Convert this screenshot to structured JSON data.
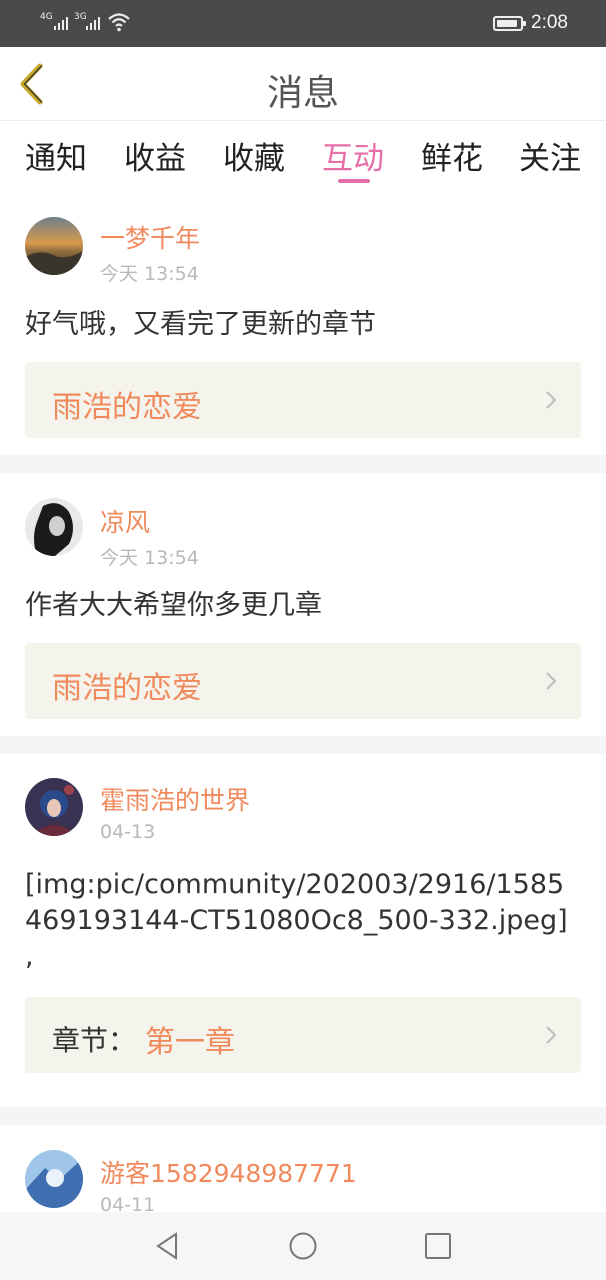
{
  "status_bar": {
    "signal1_label": "4G",
    "signal2_label": "3G",
    "wifi_icon": "wifi-icon",
    "battery_level": 0.9,
    "time": "2:08"
  },
  "header": {
    "title": "消息",
    "back_icon": "chevron-left-icon",
    "accent_color": "#c8a824"
  },
  "tabs": {
    "items": [
      {
        "label": "通知"
      },
      {
        "label": "收益"
      },
      {
        "label": "收藏"
      },
      {
        "label": "互动"
      },
      {
        "label": "鲜花"
      },
      {
        "label": "关注"
      }
    ],
    "active": "互动",
    "active_color": "#e76fa8"
  },
  "messages": [
    {
      "username": "一梦千年",
      "time": "今天 13:54",
      "content": "好气哦，又看完了更新的章节",
      "book_title": "雨浩的恋爱"
    },
    {
      "username": "凉风",
      "time": "今天 13:54",
      "content": "作者大大希望你多更几章",
      "book_title": "雨浩的恋爱"
    },
    {
      "username": "霍雨浩的世界",
      "time": "04-13",
      "content": "[img:pic/community/202003/2916/1585469193144-CT51080Oc8_500-332.jpeg] ,",
      "chapter_label": "章节：",
      "chapter_value": "第一章"
    },
    {
      "username": "游客1582948987771",
      "time": "04-11"
    }
  ],
  "colors": {
    "username": "#f08a5d",
    "timestamp": "#b9b9b9",
    "card_ref_bg": "#f4f4ec"
  },
  "navbar": {
    "back_icon": "triangle-back-icon",
    "home_icon": "circle-home-icon",
    "recents_icon": "square-recents-icon"
  }
}
